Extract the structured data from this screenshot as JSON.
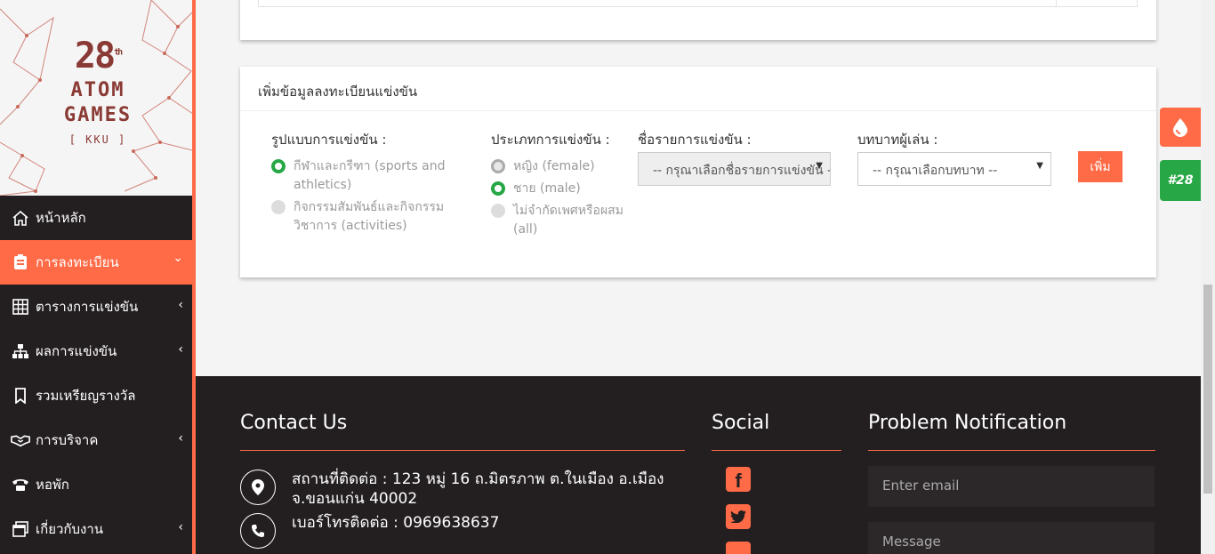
{
  "sidebar": {
    "logo": {
      "number": "28",
      "sup": "th",
      "line1": "ATOM",
      "line2": "GAMES",
      "tag": "[ KKU ]"
    },
    "items": [
      {
        "label": "หน้าหลัก",
        "icon": "home-icon",
        "active": false,
        "chevron": ""
      },
      {
        "label": "การลงทะเบียน",
        "icon": "register-icon",
        "active": true,
        "chevron": "⌄"
      },
      {
        "label": "ตารางการแข่งขัน",
        "icon": "table-icon",
        "active": false,
        "chevron": "‹"
      },
      {
        "label": "ผลการแข่งขัน",
        "icon": "sitemap-icon",
        "active": false,
        "chevron": "‹"
      },
      {
        "label": "รวมเหรียญรางวัล",
        "icon": "bookmark-icon",
        "active": false,
        "chevron": ""
      },
      {
        "label": "การบริจาค",
        "icon": "handshake-icon",
        "active": false,
        "chevron": "‹"
      },
      {
        "label": "หอพัก",
        "icon": "phone-icon",
        "active": false,
        "chevron": ""
      },
      {
        "label": "เกี่ยวกับงาน",
        "icon": "window-icon",
        "active": false,
        "chevron": "‹"
      }
    ]
  },
  "form": {
    "header": "เพิ่มข้อมูลลงทะเบียนแข่งขัน",
    "format": {
      "title": "รูปแบบการแข่งขัน :",
      "options": [
        {
          "label": "กีฬาและกรีฑา (sports and athletics)",
          "state": "checked"
        },
        {
          "label": "กิจกรรมสัมพันธ์และกิจกรรมวิชาการ (activities)",
          "state": "disabled"
        }
      ]
    },
    "type": {
      "title": "ประเภทการแข่งขัน :",
      "options": [
        {
          "label": "หญิง (female)",
          "state": "outlined"
        },
        {
          "label": "ชาย (male)",
          "state": "checked"
        },
        {
          "label": "ไม่จำกัดเพศหรือผสม (all)",
          "state": "disabled"
        }
      ]
    },
    "event": {
      "title": "ชื่อรายการแข่งขัน :",
      "selected": "-- กรุณาเลือกชื่อรายการแข่งขัน --"
    },
    "role": {
      "title": "บทบาทผู้เล่น :",
      "selected": "-- กรุณาเลือกบทบาท --"
    },
    "add_label": "เพิ่ม"
  },
  "floating": {
    "badge_label": "#28"
  },
  "footer": {
    "contact_title": "Contact Us",
    "address": "สถานที่ติดต่อ : 123 หมู่ 16 ถ.มิตรภาพ ต.ในเมือง อ.เมือง จ.ขอนแก่น 40002",
    "phone": "เบอร์โทรติดต่อ : 0969638637",
    "social_title": "Social",
    "problem_title": "Problem Notification",
    "email_placeholder": "Enter email",
    "message_placeholder": "Message"
  },
  "colors": {
    "accent": "#ff6a47",
    "dark": "#231f20",
    "green": "#27a745"
  }
}
